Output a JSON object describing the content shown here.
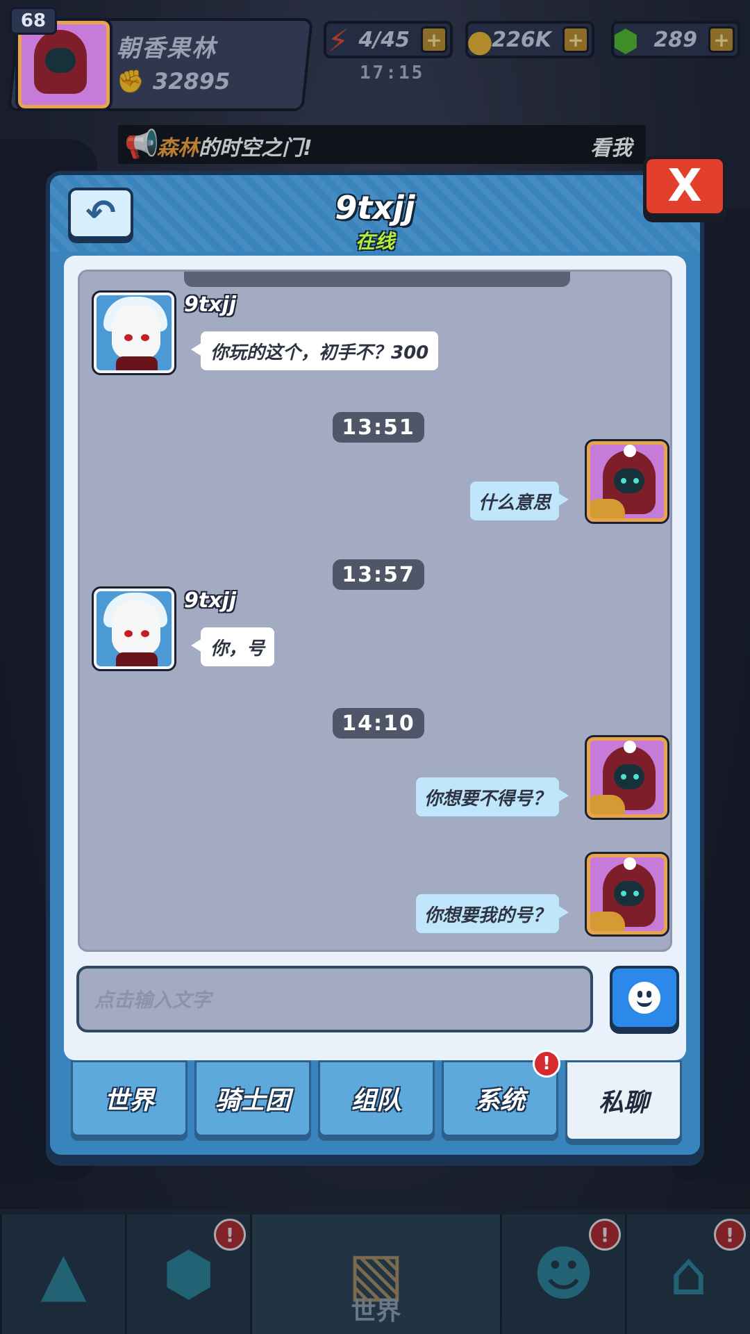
{
  "hud": {
    "level": "68",
    "player_name": "朝香果林",
    "power": "32895",
    "energy": "4/45",
    "energy_timer": "17:15",
    "gold": "226K",
    "gems": "289",
    "plus": "+"
  },
  "announcement": {
    "highlight": "森林",
    "text": "的时空之门!",
    "tail": "看我"
  },
  "chat": {
    "contact_name": "9txjj",
    "status": "在线",
    "close_label": "X",
    "back_icon": "back-arrow-icon",
    "messages": [
      {
        "from": "other",
        "sender": "9txjj",
        "text": "你玩的这个，初手不？300"
      },
      {
        "time": "13:51"
      },
      {
        "from": "self",
        "text": "什么意思"
      },
      {
        "time": "13:57"
      },
      {
        "from": "other",
        "sender": "9txjj",
        "text": "你，号"
      },
      {
        "time": "14:10"
      },
      {
        "from": "self",
        "text": "你想要不得号？"
      },
      {
        "from": "self",
        "text": "你想要我的号？"
      }
    ],
    "input_placeholder": "点击输入文字",
    "emoji_icon": "smiley-icon"
  },
  "tabs": [
    {
      "label": "世界",
      "active": false
    },
    {
      "label": "骑士团",
      "active": false
    },
    {
      "label": "组队",
      "active": false
    },
    {
      "label": "系统",
      "active": false,
      "alert": "!"
    },
    {
      "label": "私聊",
      "active": true
    }
  ],
  "bottom_nav": {
    "world_label": "世界",
    "alert": "!"
  },
  "colors": {
    "panel": "#3a84bd",
    "close": "#e2402d",
    "online": "#b4f03a",
    "bubble_self": "#bfe6fb",
    "bubble_other": "#ffffff"
  }
}
